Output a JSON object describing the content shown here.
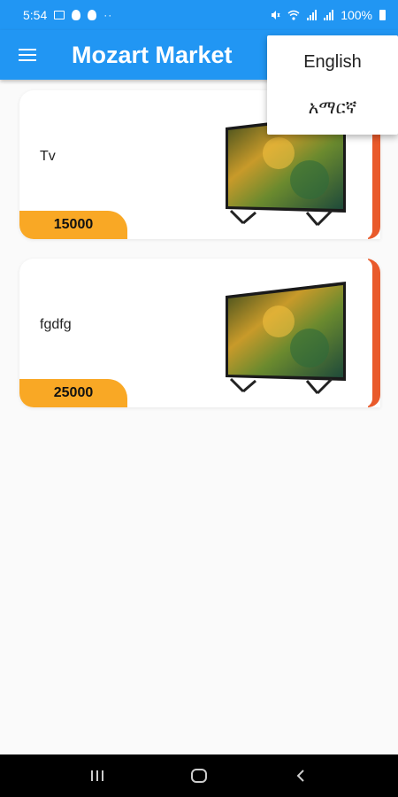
{
  "status_bar": {
    "time": "5:54",
    "battery": "100%"
  },
  "app_bar": {
    "title": "Mozart Market"
  },
  "products": [
    {
      "name": "Tv",
      "price": "15000"
    },
    {
      "name": "fgdfg",
      "price": "25000"
    }
  ],
  "language_menu": {
    "items": [
      "English",
      "አማርኛ"
    ]
  },
  "colors": {
    "primary": "#2196f3",
    "accent": "#e95a2b",
    "price_badge": "#f9a825"
  },
  "icons": {
    "menu": "hamburger-menu-icon",
    "recent": "recent-apps-icon",
    "home": "home-icon",
    "back": "back-icon"
  }
}
